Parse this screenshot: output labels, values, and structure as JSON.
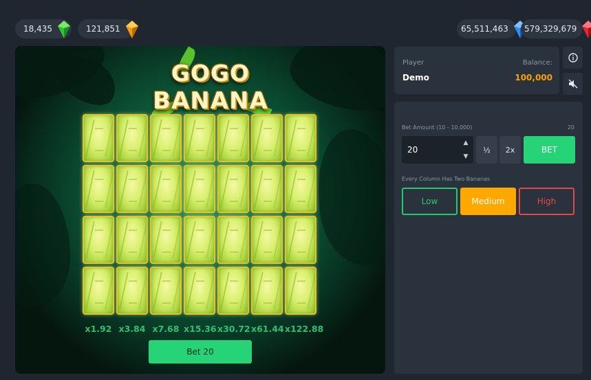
{
  "top_bar": {
    "gems_left": [
      {
        "value": "18,435",
        "icon": "green-gem-icon",
        "color": "#2fc531"
      },
      {
        "value": "121,851",
        "icon": "orange-gem-icon",
        "color": "#f59a0c"
      }
    ],
    "gems_right": [
      {
        "value": "65,511,463",
        "icon": "blue-gem-icon",
        "color": "#2f8cf0"
      },
      {
        "value": "579,329,679",
        "icon": "red-gem-icon",
        "color": "#e02b35"
      }
    ]
  },
  "game": {
    "logo_line1": "GOGO",
    "logo_line2": "BANANA",
    "columns": 7,
    "rows": 4,
    "multipliers": [
      "x1.92",
      "x3.84",
      "x7.68",
      "x15.36",
      "x30.72",
      "x61.44",
      "x122.88"
    ],
    "bet_button": "Bet 20"
  },
  "player": {
    "label": "Player",
    "name": "Demo",
    "balance_label": "Balance:",
    "balance": "100,000"
  },
  "controls": {
    "bet_amount_label": "Bet Amount (10 - 10,000)",
    "bet_amount_max": "20",
    "bet_amount_value": "20",
    "half_label": "½",
    "double_label": "2x",
    "bet_label": "BET",
    "mode_label": "Every Column Has Two Bananas",
    "risk": {
      "low": "Low",
      "medium": "Medium",
      "high": "High",
      "selected": "Medium"
    }
  },
  "colors": {
    "accent_green": "#26d477",
    "accent_orange": "#ffa800",
    "accent_red": "#e5484a"
  }
}
